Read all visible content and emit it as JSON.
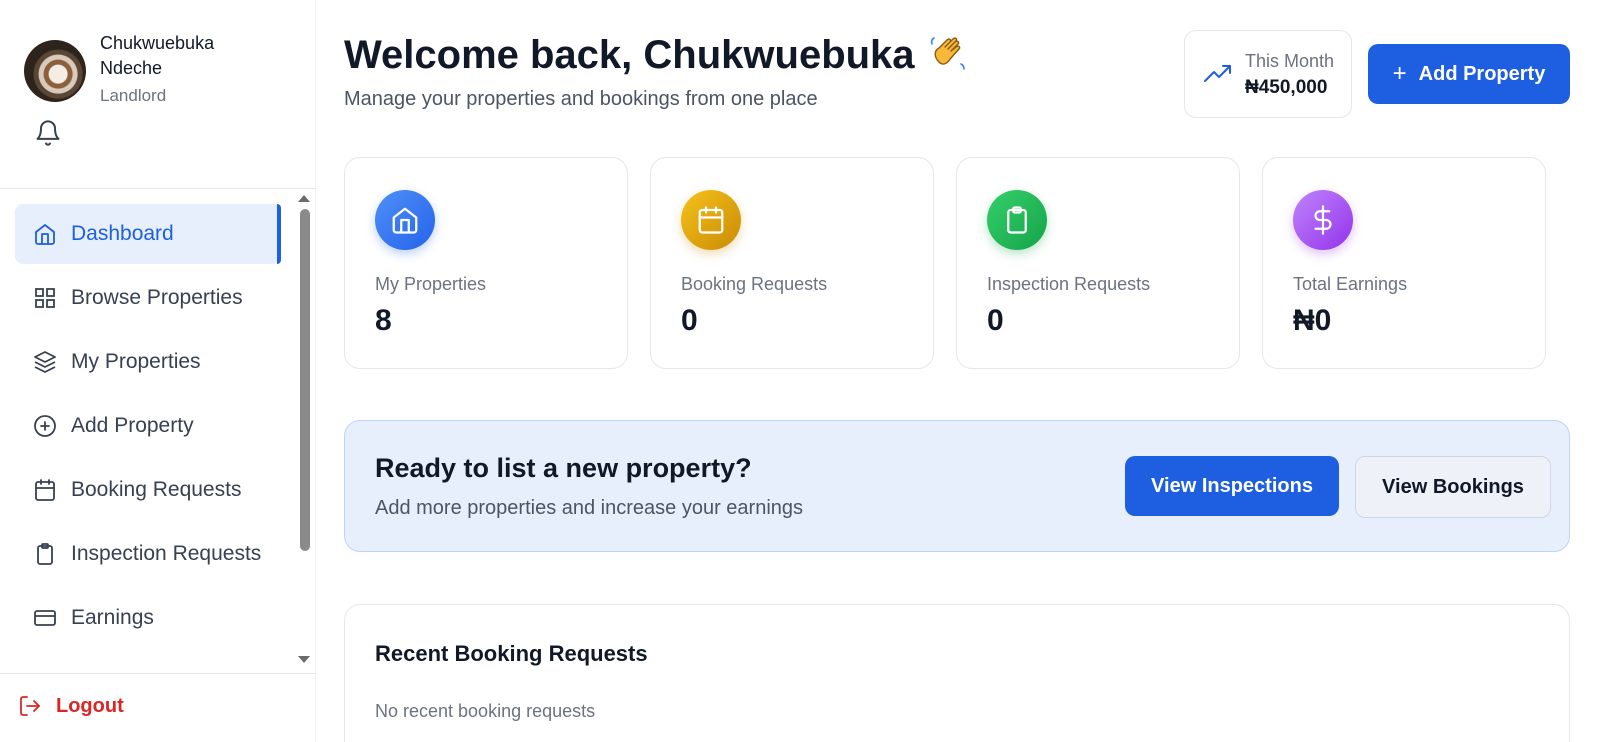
{
  "user": {
    "name": "Chukwuebuka Ndeche",
    "role": "Landlord"
  },
  "sidebar": {
    "items": [
      {
        "label": "Dashboard",
        "icon": "home-icon",
        "active": true
      },
      {
        "label": "Browse Properties",
        "icon": "grid-icon"
      },
      {
        "label": "My Properties",
        "icon": "layers-icon"
      },
      {
        "label": "Add Property",
        "icon": "plus-circle-icon"
      },
      {
        "label": "Booking Requests",
        "icon": "calendar-icon"
      },
      {
        "label": "Inspection Requests",
        "icon": "clipboard-icon"
      },
      {
        "label": "Earnings",
        "icon": "credit-card-icon"
      }
    ],
    "logout_label": "Logout"
  },
  "header": {
    "welcome": "Welcome back, Chukwuebuka",
    "subtitle": "Manage your properties and bookings from one place",
    "month_label": "This Month",
    "month_value": "₦450,000",
    "add_button": "Add Property"
  },
  "stats": [
    {
      "label": "My Properties",
      "value": "8",
      "icon": "home-icon",
      "color": "#3b82f6"
    },
    {
      "label": "Booking Requests",
      "value": "0",
      "icon": "calendar-icon",
      "color": "#eab308"
    },
    {
      "label": "Inspection Requests",
      "value": "0",
      "icon": "clipboard-icon",
      "color": "#22c55e"
    },
    {
      "label": "Total Earnings",
      "value": "₦0",
      "icon": "dollar-icon",
      "color": "#a855f7"
    }
  ],
  "cta": {
    "title": "Ready to list a new property?",
    "subtitle": "Add more properties and increase your earnings",
    "primary_button": "View Inspections",
    "secondary_button": "View Bookings"
  },
  "recent": {
    "title": "Recent Booking Requests",
    "empty": "No recent booking requests"
  },
  "colors": {
    "accent": "#1d5fe0",
    "danger": "#dc2626",
    "cta_background": "#e8effc"
  }
}
